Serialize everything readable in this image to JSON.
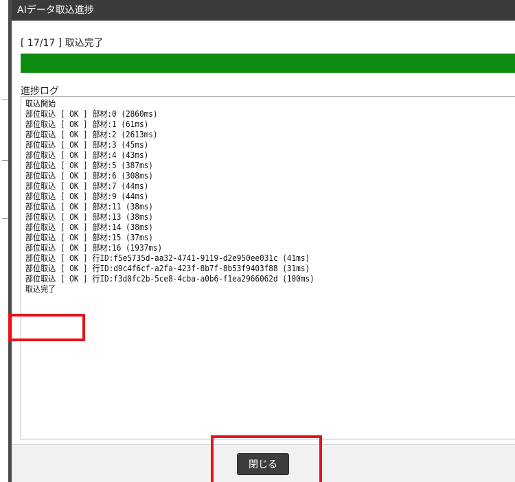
{
  "dialog": {
    "title": "AIデータ取込進捗",
    "progress": {
      "label": "[ 17/17 ] 取込完了",
      "current": 17,
      "total": 17,
      "fraction": 1.0,
      "fill_color": "#0d8a10"
    },
    "log": {
      "label": "進捗ログ",
      "lines": [
        "取込開始",
        "部位取込 [ OK ] 部材:0 (2860ms)",
        "部位取込 [ OK ] 部材:1 (61ms)",
        "部位取込 [ OK ] 部材:2 (2613ms)",
        "部位取込 [ OK ] 部材:3 (45ms)",
        "部位取込 [ OK ] 部材:4 (43ms)",
        "部位取込 [ OK ] 部材:5 (387ms)",
        "部位取込 [ OK ] 部材:6 (308ms)",
        "部位取込 [ OK ] 部材:7 (44ms)",
        "部位取込 [ OK ] 部材:9 (44ms)",
        "部位取込 [ OK ] 部材:11 (38ms)",
        "部位取込 [ OK ] 部材:13 (38ms)",
        "部位取込 [ OK ] 部材:14 (38ms)",
        "部位取込 [ OK ] 部材:15 (37ms)",
        "部位取込 [ OK ] 部材:16 (1937ms)",
        "部位取込 [ OK ] 行ID:f5e5735d-aa32-4741-9119-d2e950ee031c (41ms)",
        "部位取込 [ OK ] 行ID:d9c4f6cf-a2fa-423f-8b7f-8b53f9403f88 (31ms)",
        "部位取込 [ OK ] 行ID:f3d0fc2b-5ce8-4cba-a0b6-f1ea2966062d (100ms)",
        "取込完了"
      ]
    },
    "close_label": "閉じる"
  },
  "colors": {
    "titlebar": "#3b3b3b",
    "progress_fill": "#0d8a10",
    "highlight": "#e8141b",
    "button": "#3d3d3d"
  }
}
